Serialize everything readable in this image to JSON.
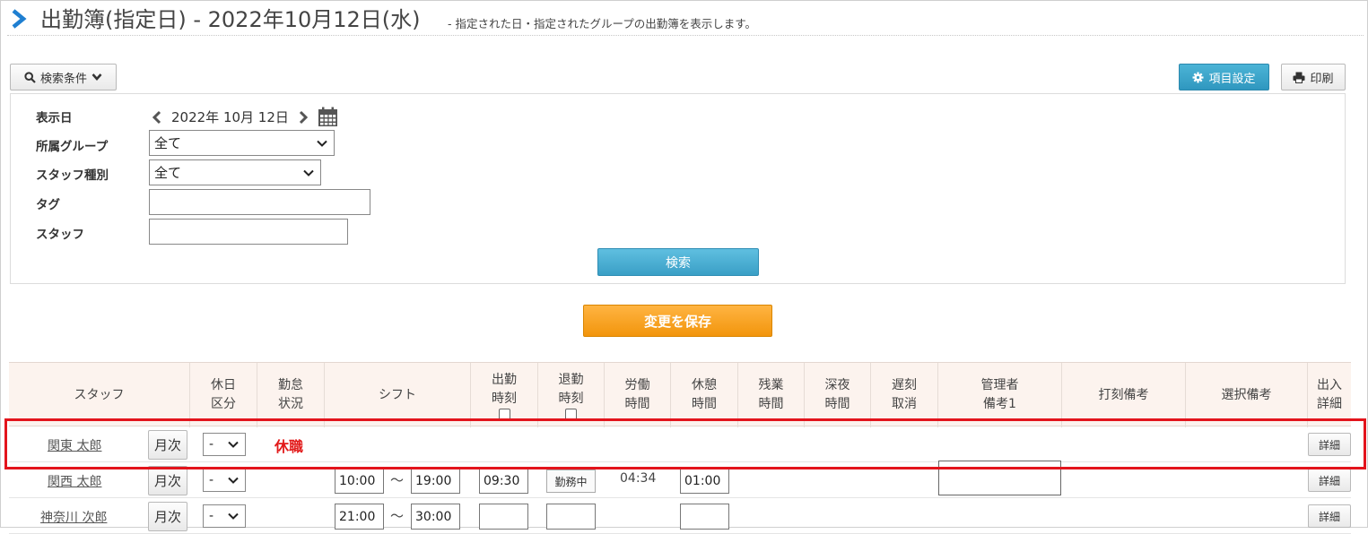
{
  "header": {
    "title": "出勤簿(指定日) - 2022年10月12日(水)",
    "subtitle": "- 指定された日・指定されたグループの出勤簿を表示します。"
  },
  "toolbar": {
    "search_conditions_label": "検索条件",
    "settings_label": "項目設定",
    "print_label": "印刷"
  },
  "filters": {
    "date_label": "表示日",
    "date_value": "2022年 10月 12日",
    "group_label": "所属グループ",
    "group_value": "全て",
    "staff_type_label": "スタッフ種別",
    "staff_type_value": "全て",
    "tag_label": "タグ",
    "tag_value": "",
    "staff_label": "スタッフ",
    "staff_value": "",
    "search_button": "検索"
  },
  "save_button": "変更を保存",
  "table": {
    "headers": {
      "staff": "スタッフ",
      "holiday_1": "休日",
      "holiday_2": "区分",
      "status_1": "勤怠",
      "status_2": "状況",
      "shift": "シフト",
      "clock_in_1": "出勤",
      "clock_in_2": "時刻",
      "clock_out_1": "退勤",
      "clock_out_2": "時刻",
      "work_1": "労働",
      "work_2": "時間",
      "break_1": "休憩",
      "break_2": "時間",
      "overtime_1": "残業",
      "overtime_2": "時間",
      "night_1": "深夜",
      "night_2": "時間",
      "late_1": "遅刻",
      "late_2": "取消",
      "admin_1": "管理者",
      "admin_2": "備考1",
      "stamp_note": "打刻備考",
      "select_note": "選択備考",
      "inout_1": "出入",
      "inout_2": "詳細"
    },
    "month_label": "月次",
    "detail_label": "詳細",
    "rows": [
      {
        "name": "関東 太郎",
        "holiday": "-",
        "status": "休職"
      },
      {
        "name": "関西 太郎",
        "holiday": "-",
        "shift_start": "10:00",
        "shift_end": "19:00",
        "clock_in": "09:30",
        "clock_out_badge": "勤務中",
        "work": "04:34",
        "break": "01:00"
      },
      {
        "name": "神奈川 次郎",
        "holiday": "-",
        "shift_start": "21:00",
        "shift_end": "30:00",
        "clock_in": "",
        "clock_out": "",
        "break": ""
      }
    ],
    "tilde": "〜"
  },
  "colors": {
    "accent_blue": "#3a9fc6",
    "save_orange": "#f2950c",
    "highlight_red": "#e3141c",
    "header_bg": "#fcf3ee"
  }
}
